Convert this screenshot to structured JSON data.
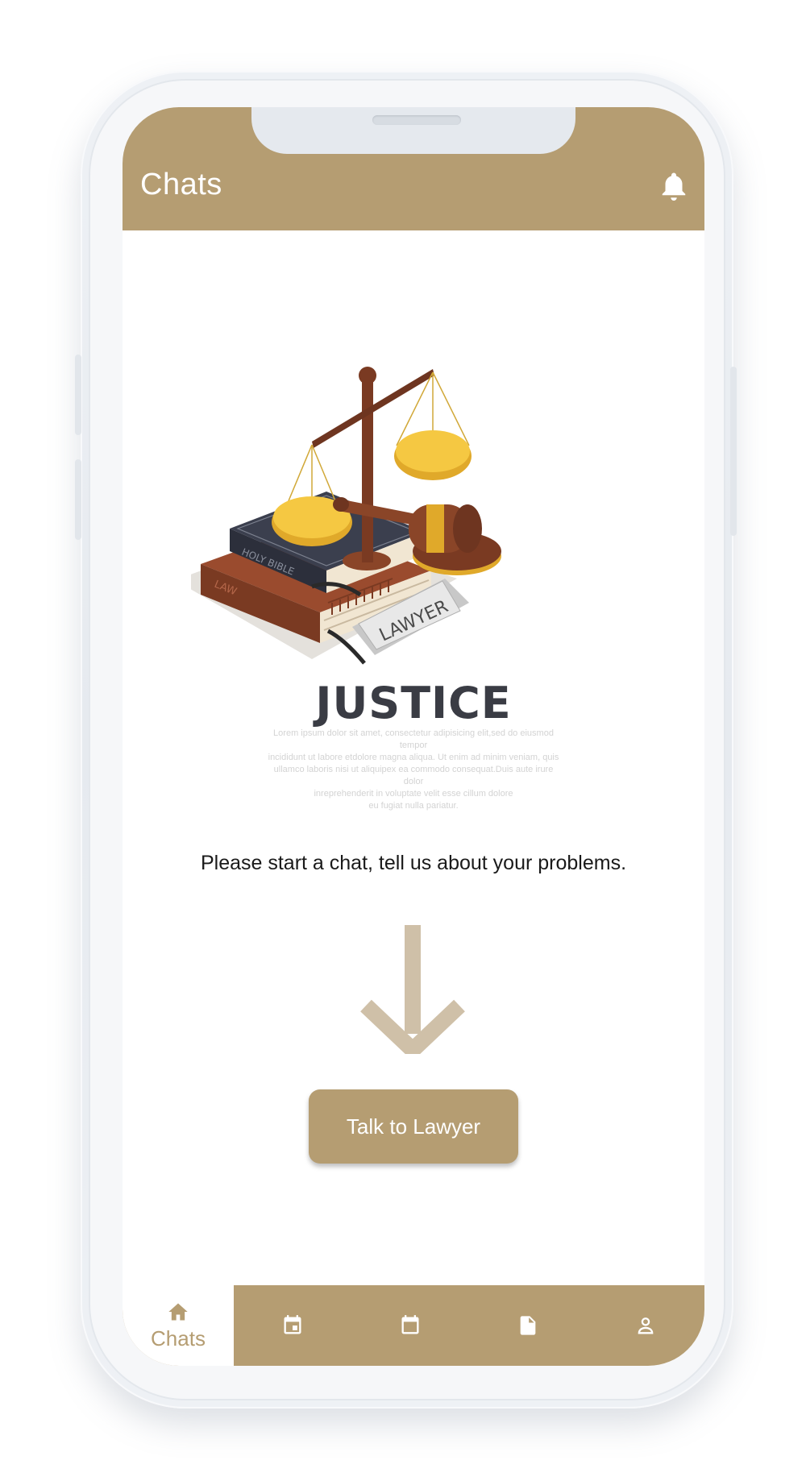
{
  "header": {
    "title": "Chats",
    "notification_icon": "bell-icon"
  },
  "illustration": {
    "heading": "JUSTICE",
    "sign_text": "LAWYER",
    "book_top_label": "HOLY BIBLE",
    "book_bottom_label": "LAW",
    "lorem_lines": [
      "Lorem ipsum dolor sit amet, consectetur adipisicing elit,sed do eiusmod tempor",
      "incididunt ut labore etdolore magna aliqua. Ut enim ad minim veniam, quis",
      "ullamco laboris nisi ut aliquipex ea commodo consequat.Duis aute irure dolor",
      "inreprehenderit in voluptate velit esse cillum dolore",
      "eu fugiat nulla pariatur."
    ]
  },
  "main": {
    "prompt": "Please start a chat, tell us about your problems.",
    "cta_label": "Talk to Lawyer"
  },
  "bottom_nav": {
    "items": [
      {
        "label": "Chats",
        "icon": "home-icon",
        "active": true
      },
      {
        "label": "",
        "icon": "calendar-event-icon",
        "active": false
      },
      {
        "label": "",
        "icon": "calendar-icon",
        "active": false
      },
      {
        "label": "",
        "icon": "document-icon",
        "active": false
      },
      {
        "label": "",
        "icon": "profile-icon",
        "active": false
      }
    ]
  },
  "colors": {
    "brand": "#b59d72",
    "arrow": "#cfc0a8",
    "gold": "#f5c842",
    "wood": "#7a3f25"
  }
}
